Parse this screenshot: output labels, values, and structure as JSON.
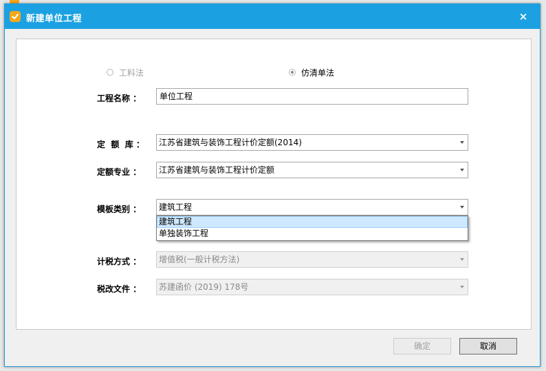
{
  "dialog": {
    "title": "新建单位工程",
    "close_label": "×"
  },
  "method": {
    "option1": {
      "label": "工料法",
      "checked": false,
      "enabled": false
    },
    "option2": {
      "label": "仿清单法",
      "checked": true,
      "enabled": true
    }
  },
  "fields": {
    "project_name": {
      "label": "工程名称 ：",
      "value": "单位工程"
    },
    "quota_library": {
      "label": "定  额  库 ：",
      "value": "江苏省建筑与装饰工程计价定额(2014)"
    },
    "quota_specialty": {
      "label": "定额专业 ：",
      "value": "江苏省建筑与装饰工程计价定额"
    },
    "template_type": {
      "label": "模板类别 ：",
      "value": "建筑工程",
      "options": [
        "建筑工程",
        "单独装饰工程"
      ],
      "highlighted_index": 0
    },
    "tax_method": {
      "label": "计税方式 ：",
      "value": "增值税(一般计税方法)",
      "enabled": false
    },
    "tax_document": {
      "label": "税改文件 ：",
      "value": "苏建函价 (2019) 178号",
      "enabled": false
    }
  },
  "buttons": {
    "ok": {
      "label": "确定",
      "enabled": false
    },
    "cancel": {
      "label": "取消",
      "enabled": true
    }
  },
  "colors": {
    "titlebar": "#1ba1e2",
    "highlight": "#cde8ff",
    "app_icon": "#f7a71b"
  },
  "icons": {
    "app": "app-logo-icon",
    "close": "close-icon",
    "dropdown": "chevron-down-icon"
  }
}
